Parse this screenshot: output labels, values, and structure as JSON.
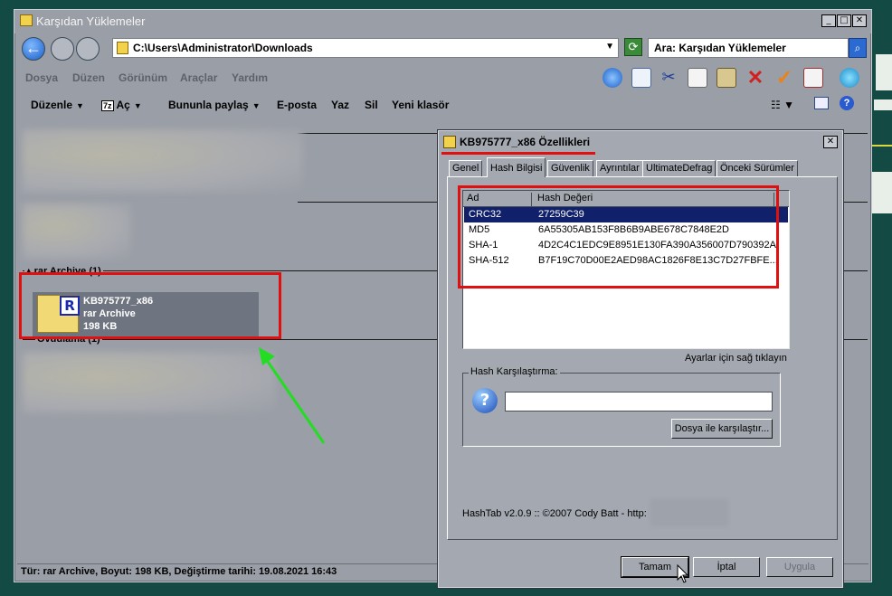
{
  "window": {
    "title": "Karşıdan Yüklemeler",
    "address": "C:\\Users\\Administrator\\Downloads",
    "search_placeholder": "Ara: Karşıdan Yüklemeler",
    "min": "_",
    "max": "□",
    "close": "✕"
  },
  "menu": [
    "Dosya",
    "Düzen",
    "Görünüm",
    "Araçlar",
    "Yardım"
  ],
  "toolbar_icons": [
    "up-icon",
    "panel-icon",
    "cut-icon",
    "copy-icon",
    "paste-icon",
    "delete-icon",
    "check-icon",
    "mail-icon",
    "globe-icon"
  ],
  "commands": {
    "organize": "Düzenle",
    "open": "Aç",
    "share": "Bununla paylaş",
    "email": "E-posta",
    "print": "Yaz",
    "delete": "Sil",
    "new_folder": "Yeni klasör"
  },
  "groups": {
    "rar": "rar Archive (1)",
    "other": "Ovdulama (1)"
  },
  "file": {
    "name": "KB975777_x86",
    "type": "rar Archive",
    "size": "198 KB"
  },
  "status": "Tür: rar Archive, Boyut: 198 KB, Değiştirme tarihi: 19.08.2021 16:43",
  "dialog": {
    "title": "KB975777_x86 Özellikleri",
    "close": "✕",
    "tabs": [
      "Genel",
      "Hash Bilgisi",
      "Güvenlik",
      "Ayrıntılar",
      "UltimateDefrag",
      "Önceki Sürümler"
    ],
    "active_tab": "Hash Bilgisi",
    "columns": [
      "Ad",
      "Hash Değeri"
    ],
    "hashes": [
      {
        "name": "CRC32",
        "value": "27259C39"
      },
      {
        "name": "MD5",
        "value": "6A55305AB153F8B6B9ABE678C7848E2D"
      },
      {
        "name": "SHA-1",
        "value": "4D2C4C1EDC9E8951E130FA390A356007D790392A"
      },
      {
        "name": "SHA-512",
        "value": "B7F19C70D00E2AED98AC1826F8E13C7D27FBFE..."
      }
    ],
    "hint": "Ayarlar için sağ tıklayın",
    "compare_label": "Hash Karşılaştırma:",
    "compare_value": "",
    "compare_button": "Dosya ile karşılaştır...",
    "footer": "HashTab v2.0.9 :: ©2007 Cody Batt  - http:",
    "ok": "Tamam",
    "cancel": "İptal",
    "apply": "Uygula"
  },
  "colors": {
    "highlight": "#e01010",
    "selection": "#10206a",
    "arrow": "#22dd22"
  }
}
